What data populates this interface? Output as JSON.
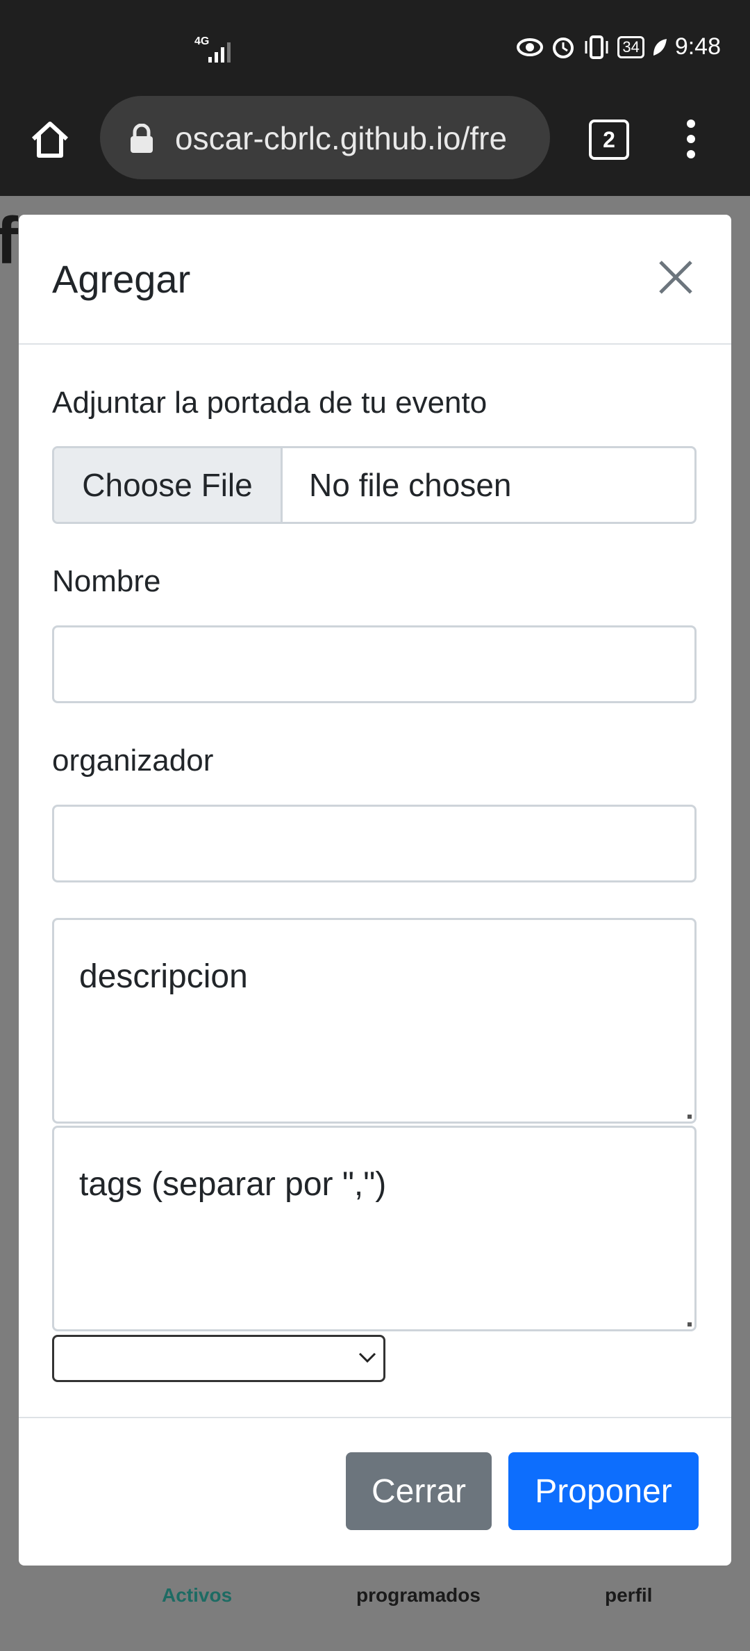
{
  "status_bar": {
    "network": "4G",
    "battery": "34",
    "time": "9:48",
    "icons": [
      "signal-icon",
      "eye-icon",
      "alarm-icon",
      "vibrate-icon",
      "battery-icon",
      "leaf-icon"
    ]
  },
  "browser": {
    "url": "oscar-cbrlc.github.io/fre",
    "tab_count": "2",
    "icons": [
      "home-icon",
      "lock-icon",
      "tabs-icon",
      "menu-icon"
    ]
  },
  "background_page": {
    "peek_letter": "f",
    "nav": {
      "item1": "Activos",
      "item2": "programados",
      "item3": "perfil"
    },
    "colors": {
      "active_nav": "#1d6b63"
    }
  },
  "modal": {
    "title": "Agregar",
    "cover_label": "Adjuntar la portada de tu evento",
    "file_button": "Choose File",
    "file_status": "No file chosen",
    "name_label": "Nombre",
    "name_value": "",
    "organizer_label": "organizador",
    "organizer_value": "",
    "description_placeholder": "descripcion",
    "tags_placeholder": "tags (separar por \",\")",
    "select_value": "",
    "close_button": "Cerrar",
    "submit_button": "Proponer",
    "colors": {
      "close_btn": "#6c757d",
      "submit_btn": "#0d6efd"
    }
  }
}
